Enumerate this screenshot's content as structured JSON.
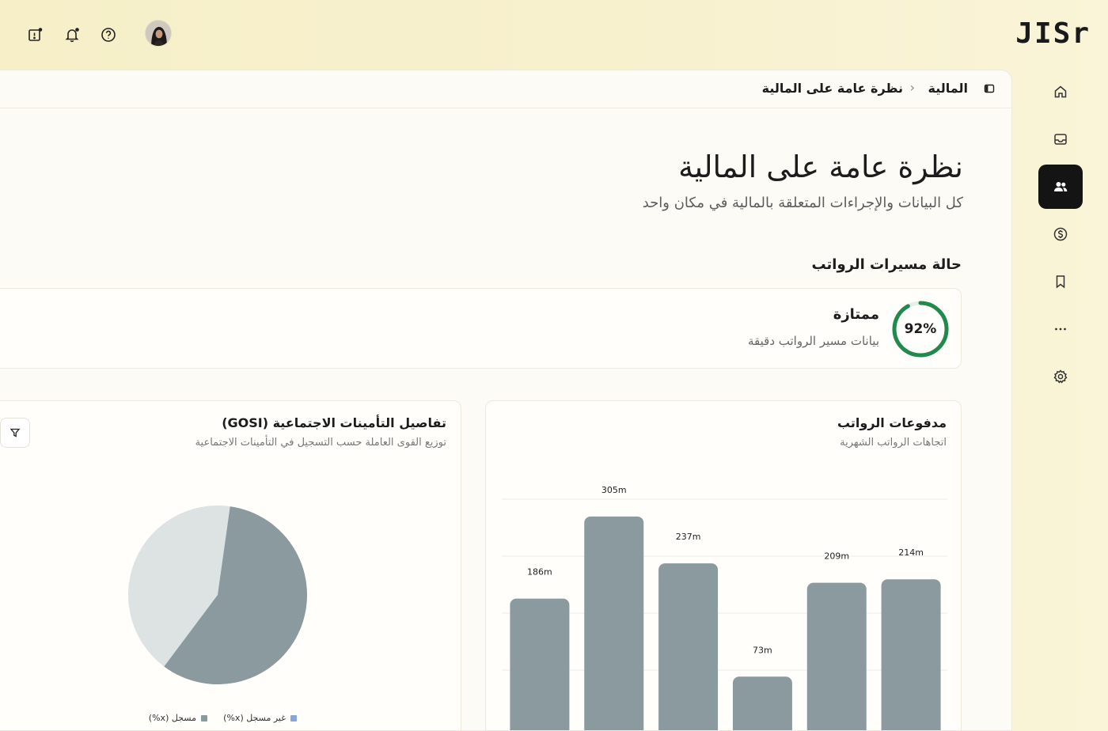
{
  "app": {
    "logo": "JISr"
  },
  "header": {
    "icons": [
      "notice-icon",
      "bell-icon",
      "help-icon"
    ],
    "avatar": "user-avatar"
  },
  "sidebar": {
    "items": [
      {
        "icon": "home-icon"
      },
      {
        "icon": "inbox-icon"
      },
      {
        "icon": "users-icon",
        "active": true
      },
      {
        "icon": "dollar-icon"
      },
      {
        "icon": "bookmark-icon"
      },
      {
        "icon": "more-icon"
      },
      {
        "icon": "settings-icon"
      }
    ]
  },
  "breadcrumb": {
    "root": "المالية",
    "current": "نظرة عامة على المالية"
  },
  "page": {
    "title": "نظرة عامة على المالية",
    "subtitle": "كل البيانات والإجراءات المتعلقة بالمالية في مكان واحد"
  },
  "payroll_status": {
    "section_title": "حالة مسيرات الرواتب",
    "percent_label": "92%",
    "percent": 0.92,
    "label": "ممتازة",
    "description": "بيانات مسير الرواتب دقيقة",
    "accent": "#1f8a4c"
  },
  "payments_card": {
    "title": "مدفوعات الرواتب",
    "subtitle": "اتجاهات الرواتب الشهرية"
  },
  "gosi_card": {
    "title": "تفاصيل التأمينات الاجتماعية (GOSI)",
    "subtitle": "توزيع القوى العاملة حسب التسجيل في التأمينات الاجتماعية",
    "filter_icon": "filter-icon"
  },
  "chart_data": [
    {
      "type": "bar",
      "categories": [
        "",
        "",
        "",
        "",
        "",
        ""
      ],
      "values": [
        186,
        305,
        237,
        73,
        209,
        214
      ],
      "data_labels": [
        "186m",
        "305m",
        "237m",
        "73m",
        "209m",
        "214m"
      ],
      "ylim": [
        0,
        330
      ],
      "grid": true,
      "color": "#8a9a9f"
    },
    {
      "type": "pie",
      "categories": [
        "غير مسجل (x%)",
        "مسجل (x%)"
      ],
      "values": [
        42,
        58
      ],
      "colors": [
        "#dde2e2",
        "#8a9a9f"
      ],
      "legend_colors": [
        "#8aa3d8",
        "#8a9a9f"
      ],
      "legend": "bottom"
    }
  ]
}
